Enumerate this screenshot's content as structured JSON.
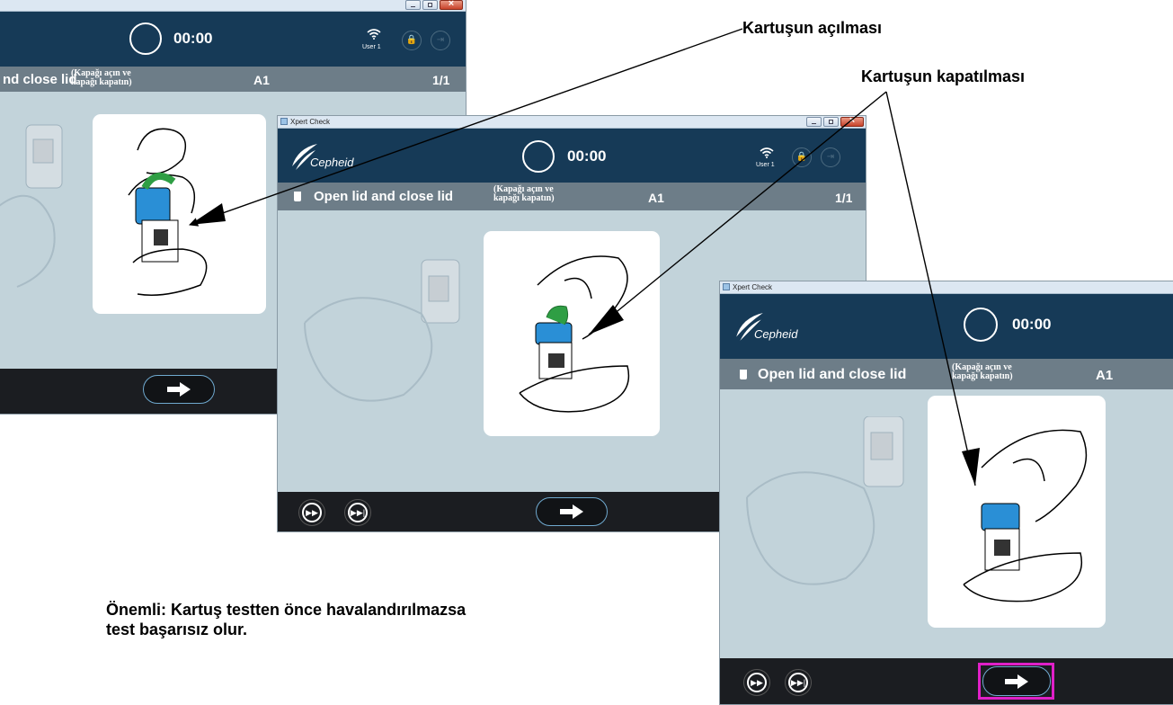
{
  "callouts": {
    "opening": "Kartuşun açılması",
    "closing": "Kartuşun kapatılması"
  },
  "note": {
    "line1": "Önemli: Kartuş testten önce havalandırılmazsa",
    "line2": "test başarısız olur."
  },
  "screen": {
    "window_title": "Xpert Check",
    "logo_text": "Cepheid",
    "timer": "00:00",
    "user": "User 1",
    "step_title": "Open lid and close lid",
    "step_title_partial": "nd close lid",
    "translation_line1": "(Kapağı açın ve",
    "translation_line2": "kapağı kapatın)",
    "position": "A1",
    "counter": "1/1"
  },
  "colors": {
    "header": "#163a57",
    "step_bar": "#6d7d88",
    "content_bg": "#c2d3da",
    "footer": "#1b1d21",
    "highlight": "#e020c8"
  },
  "icons": [
    "wifi-icon",
    "fast-forward-icon",
    "skip-to-end-icon",
    "next-arrow-icon",
    "cup-icon"
  ]
}
